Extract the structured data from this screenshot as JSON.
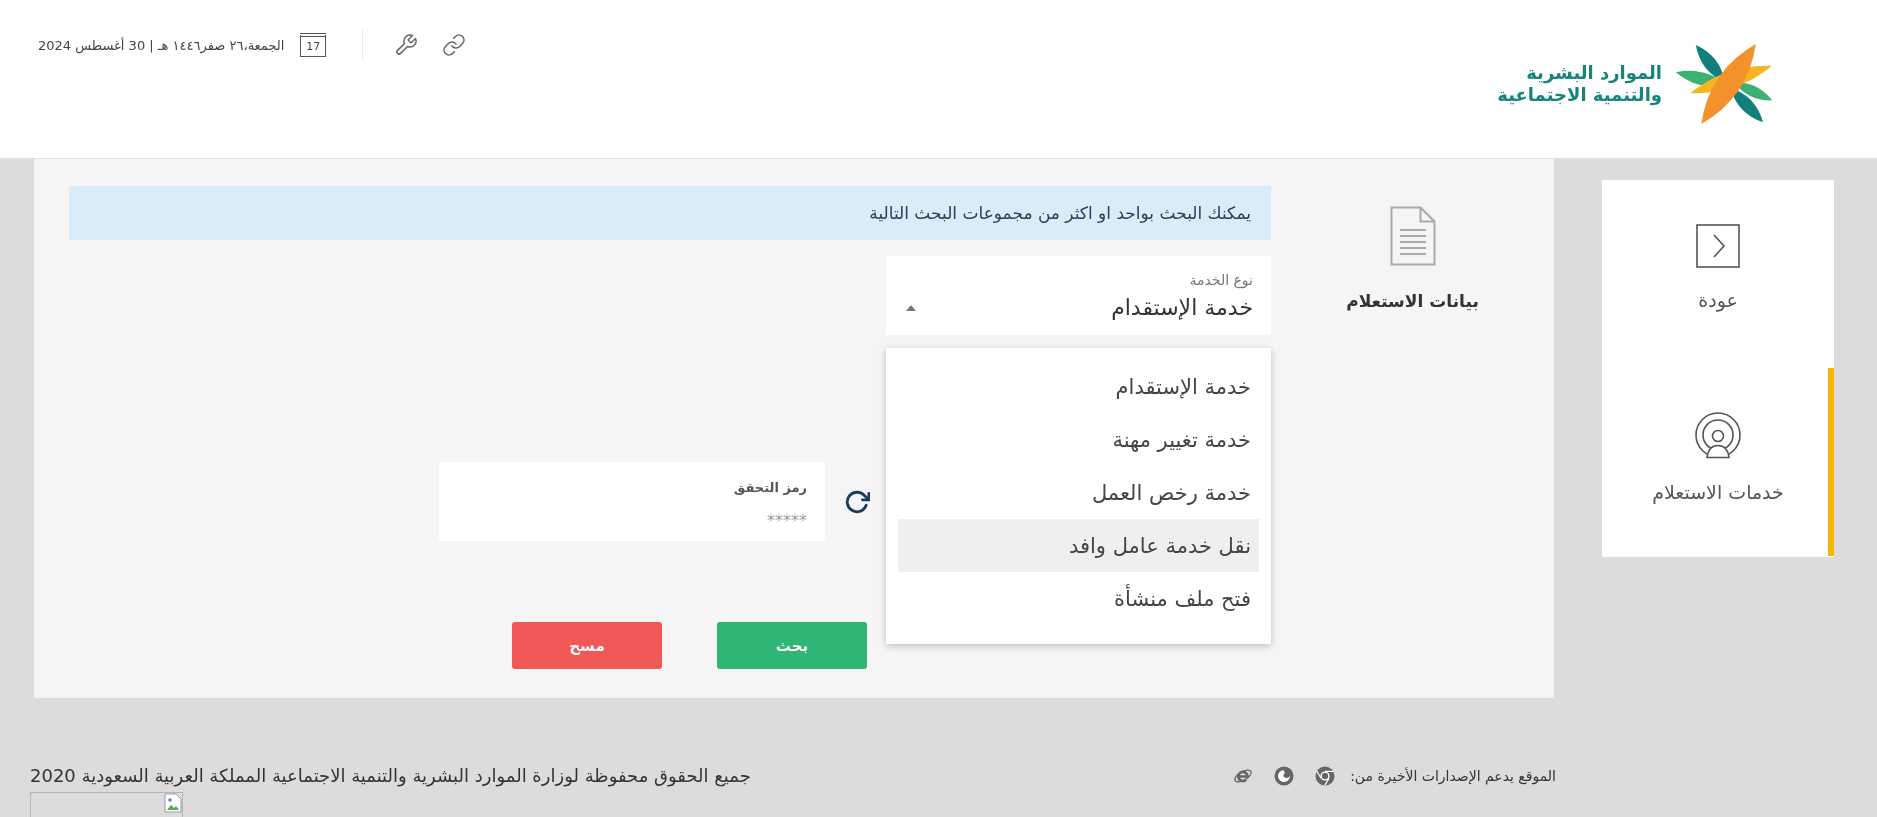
{
  "header": {
    "logo": {
      "lines": [
        "الموارد البشرية",
        "والتنمية الاجتماعية"
      ]
    },
    "calendar_day": "17",
    "date": "الجمعة،٢٦ صفر١٤٤٦ هـ | 30 أغسطس 2024"
  },
  "sidebar": {
    "items": [
      {
        "label": "عودة",
        "kind": "back",
        "selected": false
      },
      {
        "label": "خدمات الاستعلام",
        "kind": "inquiry",
        "selected": true
      }
    ]
  },
  "section": {
    "title": "بيانات الاستعلام"
  },
  "notice": "يمكنك البحث بواحد او اكثر من مجموعات البحث التالية",
  "service_type": {
    "label": "نوع الخدمة",
    "value": "خدمة الإستقدام",
    "expanded": true,
    "options": [
      {
        "label": "خدمة الإستقدام",
        "highlighted": false
      },
      {
        "label": "خدمة تغيير مهنة",
        "highlighted": false
      },
      {
        "label": "خدمة رخص العمل",
        "highlighted": false
      },
      {
        "label": "نقل خدمة عامل وافد",
        "highlighted": true
      },
      {
        "label": "فتح ملف منشأة",
        "highlighted": false
      }
    ]
  },
  "captcha": {
    "label": "رمز التحقق",
    "placeholder": "*****"
  },
  "buttons": [
    {
      "label": "بحث",
      "kind": "primary"
    },
    {
      "label": "مسح",
      "kind": "danger"
    }
  ],
  "footer": {
    "copyright": "جميع الحقوق محفوظة لوزارة الموارد البشرية والتنمية الاجتماعية المملكة العربية السعودية 2020",
    "browser_support": "الموقع يدعم الإصدارات الأخيرة من:"
  }
}
